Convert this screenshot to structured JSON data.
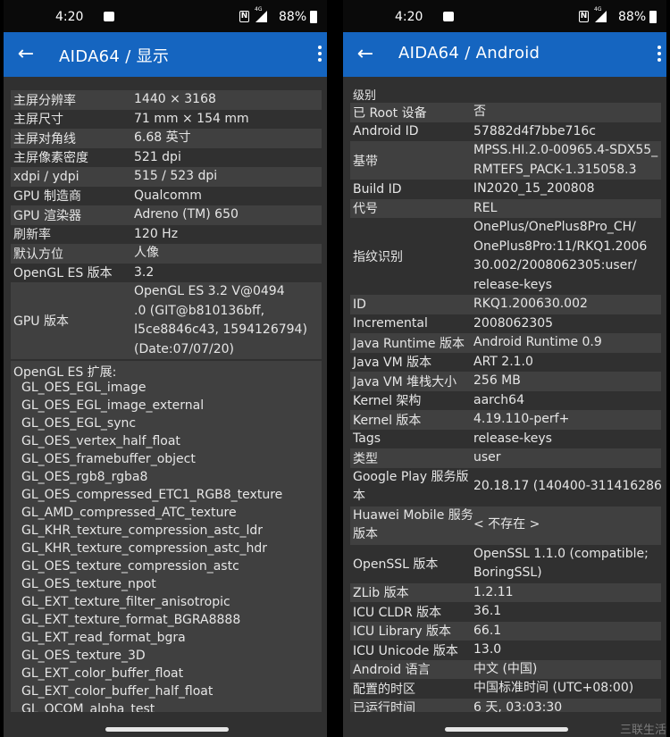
{
  "status_bar": {
    "time": "4:20",
    "battery": "88%",
    "network": "4G"
  },
  "left": {
    "title": "AIDA64  /  显示",
    "rows": [
      {
        "k": "主屏分辨率",
        "v": [
          "1440 × 3168"
        ]
      },
      {
        "k": "主屏尺寸",
        "v": [
          "71 mm × 154 mm"
        ]
      },
      {
        "k": "主屏对角线",
        "v": [
          "6.68 英寸"
        ]
      },
      {
        "k": "主屏像素密度",
        "v": [
          "521 dpi"
        ]
      },
      {
        "k": "xdpi / ydpi",
        "v": [
          "515 / 523 dpi"
        ]
      },
      {
        "k": "GPU 制造商",
        "v": [
          "Qualcomm"
        ]
      },
      {
        "k": "GPU 渲染器",
        "v": [
          "Adreno (TM) 650"
        ]
      },
      {
        "k": "刷新率",
        "v": [
          "120 Hz"
        ]
      },
      {
        "k": "默认方位",
        "v": [
          "人像"
        ]
      },
      {
        "k": "OpenGL ES 版本",
        "v": [
          "3.2"
        ]
      },
      {
        "k": "GPU 版本",
        "v": [
          "OpenGL ES 3.2 V@0494",
          ".0 (GIT@b810136bff,",
          "I5ce8846c43, 1594126794)",
          "(Date:07/07/20)"
        ]
      }
    ],
    "extensions_title": "OpenGL ES 扩展:",
    "extensions": [
      "GL_OES_EGL_image",
      "GL_OES_EGL_image_external",
      "GL_OES_EGL_sync",
      "GL_OES_vertex_half_float",
      "GL_OES_framebuffer_object",
      "GL_OES_rgb8_rgba8",
      "GL_OES_compressed_ETC1_RGB8_texture",
      "GL_AMD_compressed_ATC_texture",
      "GL_KHR_texture_compression_astc_ldr",
      "GL_KHR_texture_compression_astc_hdr",
      "GL_OES_texture_compression_astc",
      "GL_OES_texture_npot",
      "GL_EXT_texture_filter_anisotropic",
      "GL_EXT_texture_format_BGRA8888",
      "GL_EXT_read_format_bgra",
      "GL_OES_texture_3D",
      "GL_EXT_color_buffer_float",
      "GL_EXT_color_buffer_half_float",
      "GL_QCOM_alpha_test"
    ]
  },
  "right": {
    "title": "AIDA64  /  Android",
    "top_label": "级别",
    "rows": [
      {
        "k": "已 Root 设备",
        "v": [
          "否"
        ]
      },
      {
        "k": "Android ID",
        "v": [
          "57882d4f7bbe716c"
        ]
      },
      {
        "k": "基带",
        "v": [
          "MPSS.HI.2.0-00965.4-SDX55_",
          "RMTEFS_PACK-1.315058.3"
        ]
      },
      {
        "k": "Build ID",
        "v": [
          "IN2020_15_200808"
        ]
      },
      {
        "k": "代号",
        "v": [
          "REL"
        ]
      },
      {
        "k": "指纹识别",
        "v": [
          "OnePlus/OnePlus8Pro_CH/",
          "OnePlus8Pro:11/RKQ1.2006",
          "30.002/2008062305:user/",
          "release-keys"
        ]
      },
      {
        "k": "ID",
        "v": [
          "RKQ1.200630.002"
        ]
      },
      {
        "k": "Incremental",
        "v": [
          "2008062305"
        ]
      },
      {
        "k": "Java Runtime 版本",
        "v": [
          "Android Runtime 0.9"
        ]
      },
      {
        "k": "Java VM 版本",
        "v": [
          "ART 2.1.0"
        ]
      },
      {
        "k": "Java VM 堆栈大小",
        "v": [
          "256 MB"
        ]
      },
      {
        "k": "Kernel 架构",
        "v": [
          "aarch64"
        ]
      },
      {
        "k": "Kernel 版本",
        "v": [
          "4.19.110-perf+"
        ]
      },
      {
        "k": "Tags",
        "v": [
          "release-keys"
        ]
      },
      {
        "k": "类型",
        "v": [
          "user"
        ]
      },
      {
        "k": "Google Play 服务版本",
        "k2": [
          "Google Play 服务版",
          "本"
        ],
        "v": [
          "20.18.17 (140400-311416286)"
        ]
      },
      {
        "k": "Huawei Mobile 服务版本",
        "k2": [
          "Huawei Mobile 服务",
          "版本"
        ],
        "v": [
          "< 不存在 >"
        ]
      },
      {
        "k": "OpenSSL 版本",
        "v": [
          "OpenSSL 1.1.0 (compatible;",
          "BoringSSL)"
        ]
      },
      {
        "k": "ZLib 版本",
        "v": [
          "1.2.11"
        ]
      },
      {
        "k": "ICU CLDR 版本",
        "v": [
          "36.1"
        ]
      },
      {
        "k": "ICU Library 版本",
        "v": [
          "66.1"
        ]
      },
      {
        "k": "ICU Unicode 版本",
        "v": [
          "13.0"
        ]
      },
      {
        "k": "Android 语言",
        "v": [
          "中文 (中国)"
        ]
      },
      {
        "k": "配置的时区",
        "v": [
          "中国标准时间 (UTC+08:00)"
        ]
      },
      {
        "k": "已运行时间",
        "v": [
          "6 天, 03:03:30"
        ]
      }
    ]
  },
  "watermark": "三联生活"
}
